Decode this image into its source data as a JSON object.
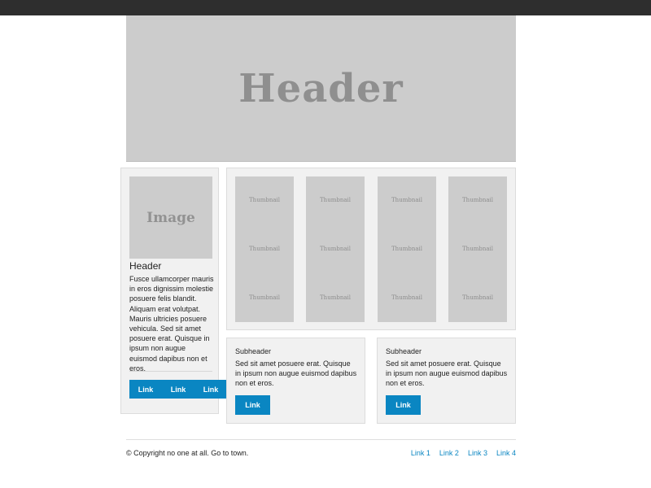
{
  "hero": {
    "title": "Header"
  },
  "sidebar": {
    "image_label": "Image",
    "title": "Header",
    "text": "Fusce ullamcorper mauris in eros dignissim molestie posuere felis blandit. Aliquam erat volutpat. Mauris ultricies posuere vehicula. Sed sit amet posuere erat. Quisque in ipsum non augue euismod dapibus non et eros.",
    "links": [
      "Link",
      "Link",
      "Link"
    ]
  },
  "thumbnails": {
    "label": "Thumbnail",
    "columns": [
      [
        "Thumbnail",
        "Thumbnail",
        "Thumbnail"
      ],
      [
        "Thumbnail",
        "Thumbnail",
        "Thumbnail"
      ],
      [
        "Thumbnail",
        "Thumbnail",
        "Thumbnail"
      ],
      [
        "Thumbnail",
        "Thumbnail",
        "Thumbnail"
      ]
    ]
  },
  "cards": [
    {
      "title": "Subheader",
      "text": "Sed sit amet posuere erat. Quisque in ipsum non augue euismod dapibus non et eros.",
      "button": "Link"
    },
    {
      "title": "Subheader",
      "text": "Sed sit amet posuere erat. Quisque in ipsum non augue euismod dapibus non et eros.",
      "button": "Link"
    }
  ],
  "footer": {
    "copyright": "© Copyright no one at all. Go to town.",
    "links": [
      "Link 1",
      "Link 2",
      "Link 3",
      "Link 4"
    ]
  },
  "colors": {
    "accent": "#0a86c2",
    "placeholder": "#cccccc",
    "panel": "#f1f1f1",
    "topbar": "#2e2e2e"
  }
}
